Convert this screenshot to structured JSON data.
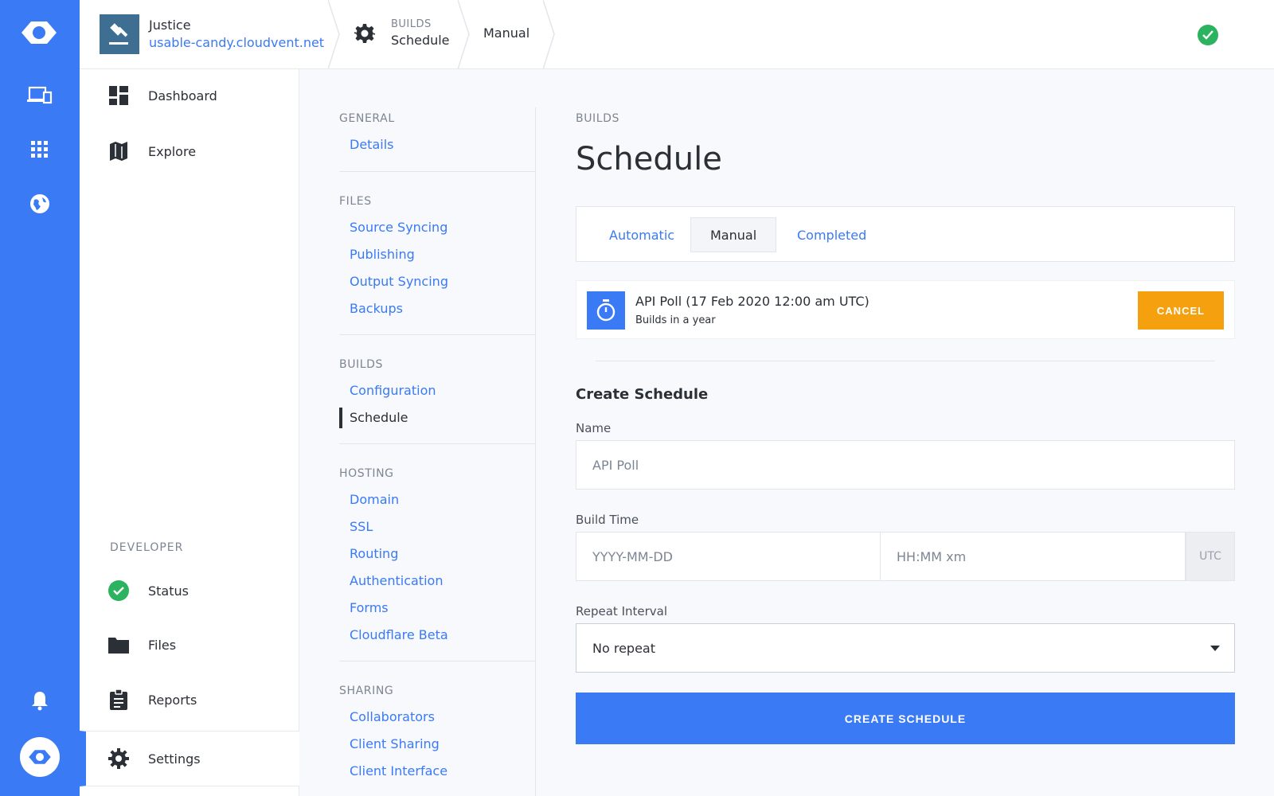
{
  "topbar": {
    "site_name": "Justice",
    "site_url": "usable-candy.cloudvent.net",
    "section_small": "BUILDS",
    "section_big": "Schedule",
    "current": "Manual"
  },
  "leftnav": {
    "dashboard": "Dashboard",
    "explore": "Explore",
    "developer_heading": "DEVELOPER",
    "status": "Status",
    "files": "Files",
    "reports": "Reports",
    "settings": "Settings"
  },
  "subnav": {
    "general": {
      "heading": "GENERAL",
      "links": [
        "Details"
      ]
    },
    "files": {
      "heading": "FILES",
      "links": [
        "Source Syncing",
        "Publishing",
        "Output Syncing",
        "Backups"
      ]
    },
    "builds": {
      "heading": "BUILDS",
      "links": [
        "Configuration",
        "Schedule"
      ]
    },
    "hosting": {
      "heading": "HOSTING",
      "links": [
        "Domain",
        "SSL",
        "Routing",
        "Authentication",
        "Forms",
        "Cloudflare Beta"
      ]
    },
    "sharing": {
      "heading": "SHARING",
      "links": [
        "Collaborators",
        "Client Sharing",
        "Client Interface"
      ]
    }
  },
  "main": {
    "eyebrow": "BUILDS",
    "title": "Schedule",
    "tabs": [
      "Automatic",
      "Manual",
      "Completed"
    ],
    "active_tab": "Manual",
    "schedule_item": {
      "title": "API Poll (17 Feb 2020 12:00 am UTC)",
      "subtitle": "Builds in a year",
      "cancel_label": "CANCEL"
    },
    "form": {
      "heading": "Create Schedule",
      "name_label": "Name",
      "name_placeholder": "API Poll",
      "build_time_label": "Build Time",
      "date_placeholder": "YYYY-MM-DD",
      "time_placeholder": "HH:MM xm",
      "tz": "UTC",
      "repeat_label": "Repeat Interval",
      "repeat_value": "No repeat",
      "submit_label": "CREATE SCHEDULE"
    }
  },
  "colors": {
    "accent": "#3a7af5",
    "warning": "#f5a00f",
    "success": "#2bb35f"
  }
}
